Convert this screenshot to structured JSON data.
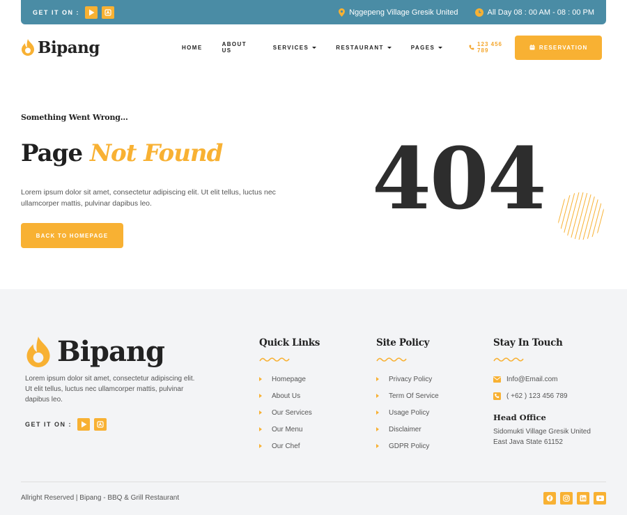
{
  "topbar": {
    "get_it_on": "GET IT ON :",
    "location": "Nggepeng Village Gresik United",
    "hours": "All Day 08 : 00 AM - 08 : 00 PM"
  },
  "header": {
    "logo_text": "Bipang",
    "nav": [
      {
        "label": "HOME",
        "has_caret": false
      },
      {
        "label": "ABOUT US",
        "has_caret": false
      },
      {
        "label": "SERVICES",
        "has_caret": true
      },
      {
        "label": "RESTAURANT",
        "has_caret": true
      },
      {
        "label": "PAGES",
        "has_caret": true
      }
    ],
    "phone": "123 456 789",
    "reservation": "RESERVATION"
  },
  "hero": {
    "subtitle": "Something Went Wrong...",
    "title_plain": "Page",
    "title_accent": "Not Found",
    "description": "Lorem ipsum dolor sit amet, consectetur adipiscing elit. Ut elit tellus, luctus nec ullamcorper mattis, pulvinar dapibus leo.",
    "button": "BACK TO HOMEPAGE",
    "code": "404"
  },
  "footer": {
    "logo_text": "Bipang",
    "description": "Lorem ipsum dolor sit amet, consectetur adipiscing elit. Ut elit tellus, luctus nec ullamcorper mattis, pulvinar dapibus leo.",
    "get_it_on": "GET IT ON :",
    "quick_links": {
      "title": "Quick Links",
      "items": [
        "Homepage",
        "About Us",
        "Our Services",
        "Our Menu",
        "Our Chef"
      ]
    },
    "site_policy": {
      "title": "Site Policy",
      "items": [
        "Privacy Policy",
        "Term Of Service",
        "Usage Policy",
        "Disclaimer",
        "GDPR Policy"
      ]
    },
    "stay_in_touch": {
      "title": "Stay In Touch",
      "email": "Info@Email.com",
      "phone": "( +62 ) 123 456 789",
      "office_title": "Head Office",
      "address_line1": "Sidomukti Village Gresik United",
      "address_line2": "East Java State 61152"
    },
    "copyright": "Allright Reserved | Bipang - BBQ & Grill Restaurant",
    "socials": [
      "facebook-icon",
      "instagram-icon",
      "linkedin-icon",
      "youtube-icon"
    ]
  },
  "colors": {
    "accent": "#f8b133",
    "topbar": "#4a8ca5",
    "footer_bg": "#f3f4f6"
  }
}
